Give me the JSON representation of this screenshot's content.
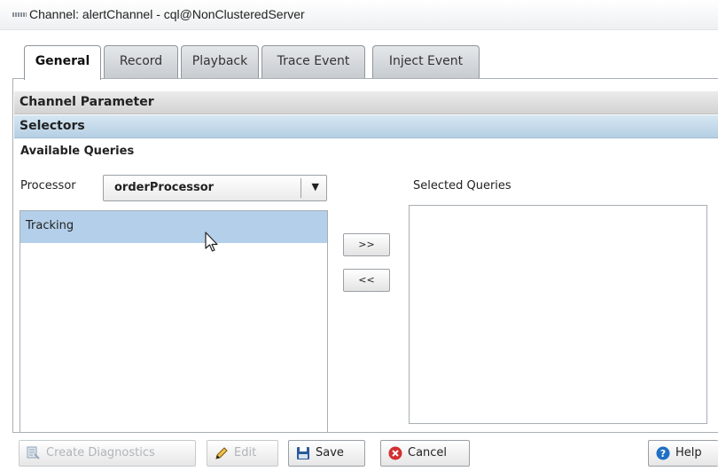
{
  "window": {
    "title": "Channel: alertChannel - cql@NonClusteredServer"
  },
  "tabs": [
    {
      "label": "General",
      "active": true
    },
    {
      "label": "Record",
      "active": false
    },
    {
      "label": "Playback",
      "active": false
    },
    {
      "label": "Trace Event",
      "active": false
    },
    {
      "label": "Inject Event",
      "active": false
    }
  ],
  "sections": {
    "channel_parameter": "Channel Parameter",
    "selectors": "Selectors"
  },
  "queries": {
    "available_label": "Available Queries",
    "processor_label": "Processor",
    "processor_value": "orderProcessor",
    "selected_label": "Selected Queries",
    "available_items": [
      "Tracking"
    ],
    "selected_items": [],
    "add_label": ">>",
    "remove_label": "<<"
  },
  "footer": {
    "create_diagnostics": "Create Diagnostics",
    "edit": "Edit",
    "save": "Save",
    "cancel": "Cancel",
    "help": "Help"
  },
  "icons": {
    "title": "drag-handle-icon",
    "dropdown": "chevron-down-icon",
    "diagnostics": "diagnostics-icon",
    "edit": "pencil-icon",
    "save": "floppy-disk-icon",
    "cancel": "cancel-x-icon",
    "help": "help-question-icon"
  },
  "colors": {
    "selected_row": "#b3cfe9",
    "section_header": "#b5cfe3",
    "cancel_red": "#d32f2f",
    "help_blue": "#1f6fc4",
    "save_blue": "#2a5b9a"
  }
}
